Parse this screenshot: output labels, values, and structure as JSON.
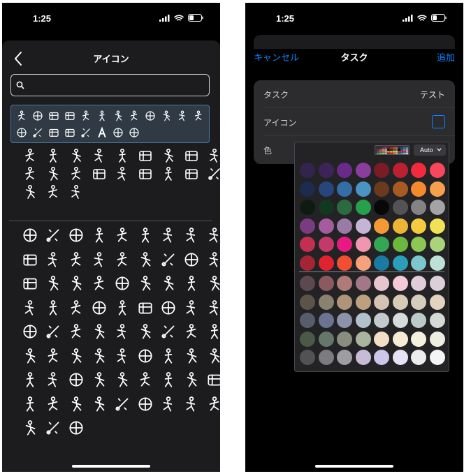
{
  "left_screen": {
    "status": {
      "time": "1:25"
    },
    "header": {
      "title": "アイコン"
    },
    "search": {
      "placeholder": "",
      "value": ""
    },
    "recent_icons": [
      "pill",
      "basketball",
      "car-side",
      "car-front",
      "gamepad",
      "crab",
      "beach-cabana",
      "scale-balance",
      "atom",
      "lizard",
      "butterfly",
      "palm-tree",
      "alarm-clock",
      "tooth",
      "facebook-square",
      "html-tag",
      "scissors",
      "letter-a",
      "smiley",
      "balloon"
    ],
    "baby_icons": [
      "baby-bottle",
      "footprints",
      "baby",
      "bib",
      "child",
      "toy-block",
      "family-group",
      "crib",
      "crying-baby",
      "parent-child",
      "mother-child",
      "stroller-mother",
      "diaper",
      "pacifier",
      "baby-food-jar",
      "rattle",
      "onesie",
      "safety-pin",
      "pram",
      "teddy-bear",
      "tricycle"
    ],
    "sports_icons": [
      "basketball",
      "weightlifting-bar",
      "baseball-bat",
      "rowing",
      "juggling",
      "bowling",
      "boxing-glove",
      "gymnast",
      "stirrup",
      "bag",
      "whistle-mask",
      "helmet",
      "dance",
      "cricket",
      "cheerleader",
      "dumbbell",
      "ball-pair",
      "sprinter",
      "checkered-flag",
      "arm-flex",
      "meditation",
      "soccer-player",
      "soccer-ball",
      "volleyball-player",
      "climber",
      "yoga",
      "badminton",
      "hockey",
      "hang-glider",
      "sailboat",
      "rings-medal",
      "surfing",
      "podium",
      "medal",
      "meditation-2",
      "cyclist",
      "olympic-rings",
      "torch",
      "kayak",
      "windsurf",
      "skiing-fall",
      "table-tennis",
      "gymnastics-bar",
      "stretch",
      "head-profile",
      "bmx-cycle",
      "ice-skating",
      "inline-skate",
      "rope-climb",
      "rower",
      "american-football",
      "runner",
      "boot",
      "hurdler",
      "skier-slope",
      "snowboard",
      "volleyball-net",
      "basketball-dunk",
      "curling",
      "cross-country-ski",
      "skateboard",
      "swimmer",
      "jersey",
      "tennis-racket",
      "mountain-biker",
      "treadmill",
      "walker",
      "trophy",
      "volleyball",
      "stairs-runner",
      "hiker",
      "weight-lifter",
      "whistle",
      "world-cup-trophy",
      "ballet"
    ]
  },
  "right_screen": {
    "status": {
      "time": "1:25"
    },
    "nav": {
      "cancel": "キャンセル",
      "title": "タスク",
      "add": "追加"
    },
    "form": {
      "task_label": "タスク",
      "task_value": "テスト",
      "icon_label": "アイコン",
      "color_label": "色"
    },
    "color_picker": {
      "mode_label": "Auto",
      "swatches_top": [
        "#33244d",
        "#3c2458",
        "#6a2a8a",
        "#8a3d9a",
        "#7a1c25",
        "#bb2030",
        "#f22a3e",
        "#f8475b",
        "#1c2c4e",
        "#26467d",
        "#346ea7",
        "#4b93c0",
        "#6a3a1c",
        "#a85a22",
        "#f48a2c",
        "#f5a04d",
        "#0e1a12",
        "#123820",
        "#2d6a3f",
        "#26a04a",
        "#080808",
        "#535355",
        "#838385",
        "#a4a4a6",
        "#7a3b80",
        "#a45ba0",
        "#9a7aa6",
        "#c4b5d6",
        "#f49a35",
        "#ebb535",
        "#f5c940",
        "#f2e156",
        "#c22f52",
        "#c4396a",
        "#e81a82",
        "#f096b0",
        "#34a654",
        "#6cb83d",
        "#8dc754",
        "#aad37b",
        "#a62535",
        "#e0232f",
        "#f44e32",
        "#f5a27c",
        "#1a7aa2",
        "#2a9fbc",
        "#7bc7cd",
        "#bde2d5"
      ],
      "swatches_bottom": [
        "#5e484f",
        "#8a5a5e",
        "#b07a78",
        "#a27886",
        "#e6c5cf",
        "#f4cad8",
        "#e2ccd9",
        "#dcd0d8",
        "#5c5447",
        "#8b8170",
        "#ae957a",
        "#bda17e",
        "#d4c3b2",
        "#d7cbb6",
        "#d6ccbc",
        "#e2d2bf",
        "#585d6b",
        "#6b7390",
        "#8d92ab",
        "#b3c1cb",
        "#c4c9cb",
        "#d6dbdc",
        "#bccac8",
        "#d4dad5",
        "#4c5848",
        "#66766a",
        "#888e7d",
        "#aab49f",
        "#f3dfc7",
        "#f6ecd4",
        "#f4f2de",
        "#eeeee0",
        "#525254",
        "#7c7c80",
        "#9e9ea2",
        "#c7bbd6",
        "#ccc7e8",
        "#e6e3f4",
        "#ececef",
        "#f4f4f6"
      ]
    }
  }
}
